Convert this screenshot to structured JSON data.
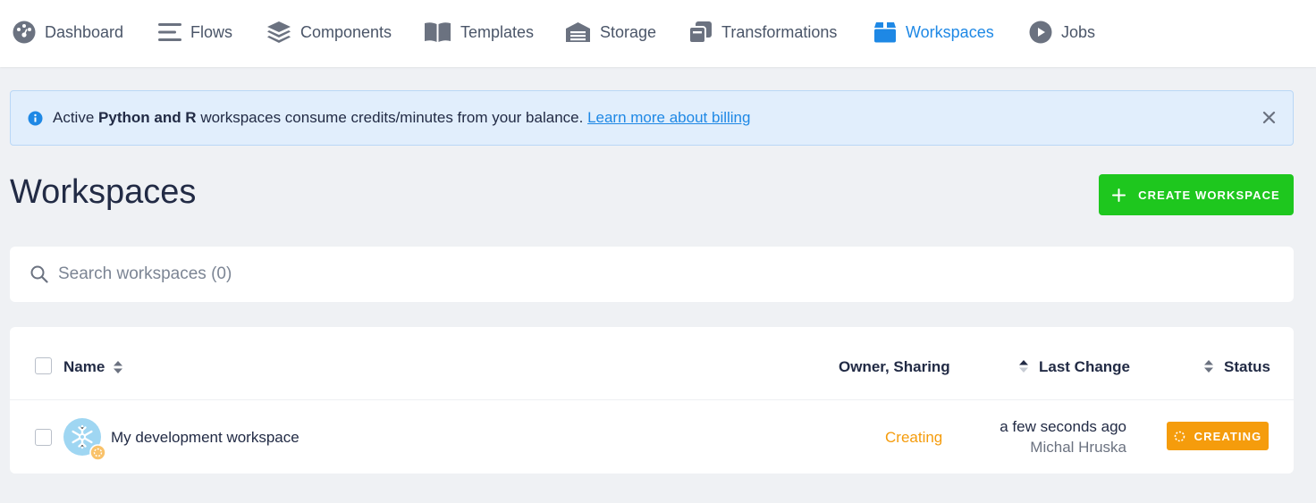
{
  "nav": {
    "items": [
      {
        "label": "Dashboard",
        "icon": "dashboard-icon"
      },
      {
        "label": "Flows",
        "icon": "flows-icon"
      },
      {
        "label": "Components",
        "icon": "components-icon"
      },
      {
        "label": "Templates",
        "icon": "templates-icon"
      },
      {
        "label": "Storage",
        "icon": "storage-icon"
      },
      {
        "label": "Transformations",
        "icon": "transformations-icon"
      },
      {
        "label": "Workspaces",
        "icon": "workspaces-icon",
        "active": true
      },
      {
        "label": "Jobs",
        "icon": "jobs-icon"
      }
    ]
  },
  "banner": {
    "prefix": "Active ",
    "bold": "Python and R",
    "suffix": " workspaces consume credits/minutes from your balance. ",
    "link": "Learn more about billing"
  },
  "page": {
    "title": "Workspaces",
    "create_label": "CREATE WORKSPACE"
  },
  "search": {
    "placeholder": "Search workspaces (0)",
    "value": ""
  },
  "table": {
    "headers": {
      "name": "Name",
      "owner": "Owner, Sharing",
      "last_change": "Last Change",
      "status": "Status"
    },
    "rows": [
      {
        "name": "My development workspace",
        "owner_status": "Creating",
        "last_change": "a few seconds ago",
        "changed_by": "Michal Hruska",
        "status": "CREATING"
      }
    ]
  },
  "colors": {
    "accent": "#1e88e5",
    "create_button": "#1ec71e",
    "creating": "#f59c0c"
  }
}
